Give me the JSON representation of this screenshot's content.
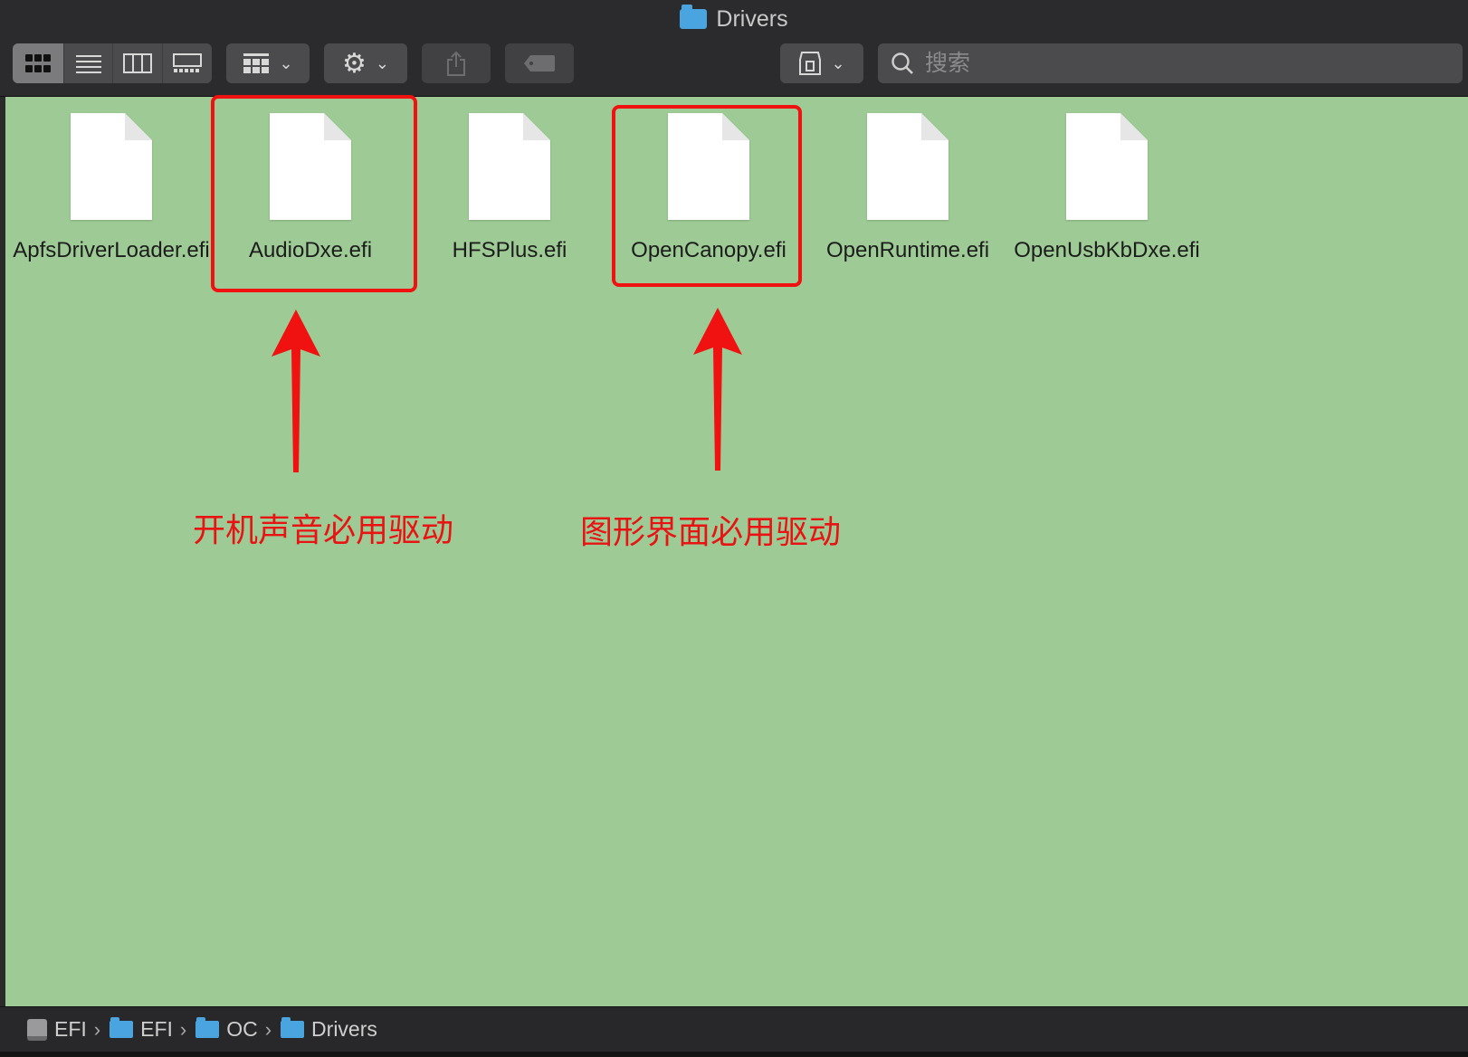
{
  "window": {
    "title": "Drivers"
  },
  "search": {
    "placeholder": "搜索"
  },
  "files": [
    {
      "name": "ApfsDriverLoader.efi",
      "highlighted": false
    },
    {
      "name": "AudioDxe.efi",
      "highlighted": true
    },
    {
      "name": "HFSPlus.efi",
      "highlighted": false
    },
    {
      "name": "OpenCanopy.efi",
      "highlighted": true
    },
    {
      "name": "OpenRuntime.efi",
      "highlighted": false
    },
    {
      "name": "OpenUsbKbDxe.efi",
      "highlighted": false
    }
  ],
  "annotations": {
    "audio_note": "开机声音必用驱动",
    "gui_note": "图形界面必用驱动",
    "color": "#e81313"
  },
  "path": [
    {
      "label": "EFI",
      "icon": "disk-icon"
    },
    {
      "label": "EFI",
      "icon": "folder-icon"
    },
    {
      "label": "OC",
      "icon": "folder-icon"
    },
    {
      "label": "Drivers",
      "icon": "folder-icon"
    }
  ],
  "colors": {
    "content_bg": "#9ecb95",
    "toolbar_bg": "#2b2b2d",
    "highlight": "#f01111"
  }
}
